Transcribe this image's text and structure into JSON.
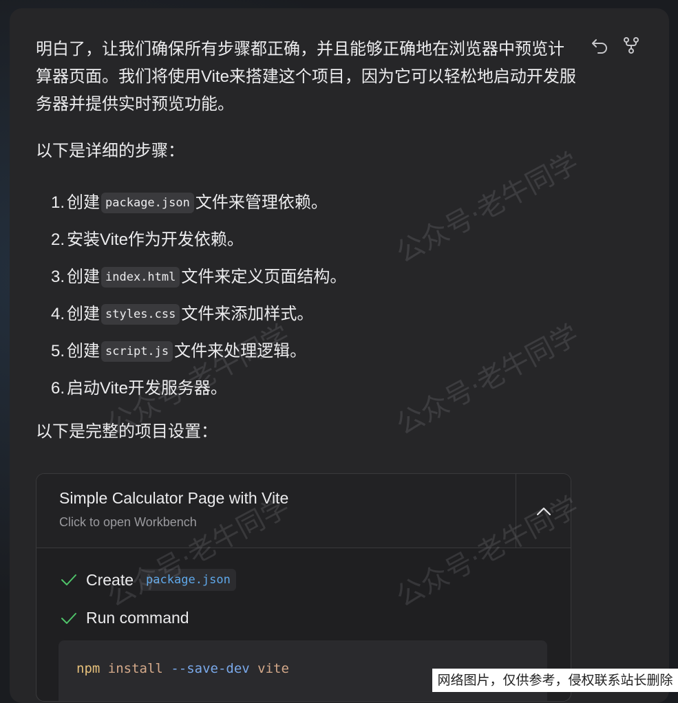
{
  "message": {
    "intro": "明白了，让我们确保所有步骤都正确，并且能够正确地在浏览器中预览计算器页面。我们将使用Vite来搭建这个项目，因为它可以轻松地启动开发服务器并提供实时预览功能。",
    "steps_heading": "以下是详细的步骤：",
    "steps": [
      {
        "num": "1.",
        "pre": "创建",
        "code": "package.json",
        "post": "文件来管理依赖。"
      },
      {
        "num": "2.",
        "pre": "安装Vite作为开发依赖。",
        "code": "",
        "post": ""
      },
      {
        "num": "3.",
        "pre": "创建",
        "code": "index.html",
        "post": "文件来定义页面结构。"
      },
      {
        "num": "4.",
        "pre": "创建",
        "code": "styles.css",
        "post": "文件来添加样式。"
      },
      {
        "num": "5.",
        "pre": "创建",
        "code": "script.js",
        "post": "文件来处理逻辑。"
      },
      {
        "num": "6.",
        "pre": "启动Vite开发服务器。",
        "code": "",
        "post": ""
      }
    ],
    "setup_heading": "以下是完整的项目设置："
  },
  "actions": {
    "undo_icon": "undo-icon",
    "fork_icon": "fork-icon"
  },
  "artifact": {
    "title": "Simple Calculator Page with Vite",
    "subtitle": "Click to open Workbench",
    "collapse_icon": "chevron-up-icon",
    "tasks": [
      {
        "label": "Create",
        "file": "package.json",
        "status": "done"
      },
      {
        "label": "Run command",
        "file": "",
        "status": "done"
      }
    ],
    "command": {
      "cmd": "npm",
      "sub": "install",
      "flag": "--save-dev",
      "pkg": "vite"
    }
  },
  "watermark": "公众号·老牛同学",
  "disclaimer": "网络图片，仅供参考，侵权联系站长删除",
  "colors": {
    "check": "#4fc46a",
    "file_code": "#5fa8ea",
    "panel": "#262628"
  }
}
